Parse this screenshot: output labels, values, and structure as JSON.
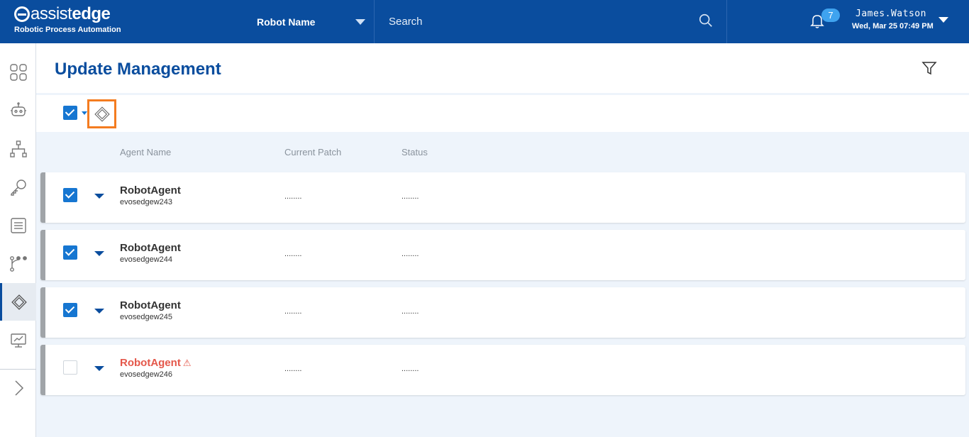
{
  "header": {
    "logo_assist": "assist",
    "logo_edge": "edge",
    "logo_sub": "Robotic Process Automation",
    "robot_select_label": "Robot Name",
    "search_placeholder": "Search",
    "notification_count": "7",
    "user_name": "James.Watson",
    "datetime": "Wed, Mar 25 07:49 PM"
  },
  "sidebar": {
    "items": [
      {
        "icon": "dashboard-grid-icon"
      },
      {
        "icon": "robot-icon"
      },
      {
        "icon": "hierarchy-icon"
      },
      {
        "icon": "key-icon"
      },
      {
        "icon": "document-list-icon"
      },
      {
        "icon": "workflow-icon"
      },
      {
        "icon": "update-management-icon",
        "active": true
      },
      {
        "icon": "monitor-chart-icon"
      }
    ],
    "expand_icon": "chevron-right-icon"
  },
  "page": {
    "title": "Update Management",
    "filter_icon": "filter-icon"
  },
  "toolbar": {
    "select_all_checked": true,
    "update_icon": "update-chip-icon"
  },
  "table": {
    "columns": [
      "Agent Name",
      "Current Patch",
      "Status"
    ],
    "rows": [
      {
        "agent": "RobotAgent",
        "host": "evosedgew243",
        "patch": "........",
        "status": "........",
        "checked": true,
        "warning": false
      },
      {
        "agent": "RobotAgent",
        "host": "evosedgew244",
        "patch": "........",
        "status": "........",
        "checked": true,
        "warning": false
      },
      {
        "agent": "RobotAgent",
        "host": "evosedgew245",
        "patch": "........",
        "status": "........",
        "checked": true,
        "warning": false
      },
      {
        "agent": "RobotAgent",
        "host": "evosedgew246",
        "patch": "........",
        "status": "........",
        "checked": false,
        "warning": true,
        "warning_glyph": "⚠"
      }
    ]
  },
  "colors": {
    "header_bg": "#0a4d9e",
    "accent": "#1676d1",
    "highlight_border": "#f47c20",
    "warning_text": "#e4574a"
  }
}
